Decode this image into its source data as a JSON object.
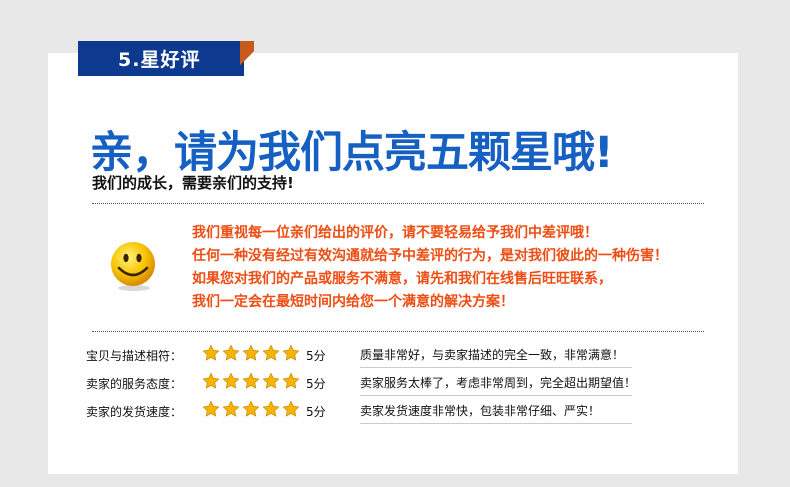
{
  "badge": {
    "label": "5.星好评"
  },
  "headline": "亲，请为我们点亮五颗星哦!",
  "subhead": "我们的成长，需要亲们的支持!",
  "notes": [
    "我们重视每一位亲们给出的评价，请不要轻易给予我们中差评哦！",
    "任何一种没有经过有效沟通就给予中差评的行为，是对我们彼此的一种伤害！",
    "如果您对我们的产品或服务不满意，请先和我们在线售后旺旺联系，",
    "我们一定会在最短时间内给您一个满意的解决方案！"
  ],
  "ratings": [
    {
      "label": "宝贝与描述相符：",
      "stars": 5,
      "score": "5分",
      "comment": "质量非常好，与卖家描述的完全一致，非常满意！"
    },
    {
      "label": "卖家的服务态度：",
      "stars": 5,
      "score": "5分",
      "comment": "卖家服务太棒了，考虑非常周到，完全超出期望值！"
    },
    {
      "label": "卖家的发货速度：",
      "stars": 5,
      "score": "5分",
      "comment": "卖家发货速度非常快，包装非常仔细、严实！"
    }
  ],
  "colors": {
    "badge": "#0d3a8f",
    "headline": "#1560c2",
    "notes": "#ee4d13",
    "star": "#f7b500"
  },
  "icons": {
    "mood": "smiley-face-icon",
    "rating": "star-icon"
  }
}
